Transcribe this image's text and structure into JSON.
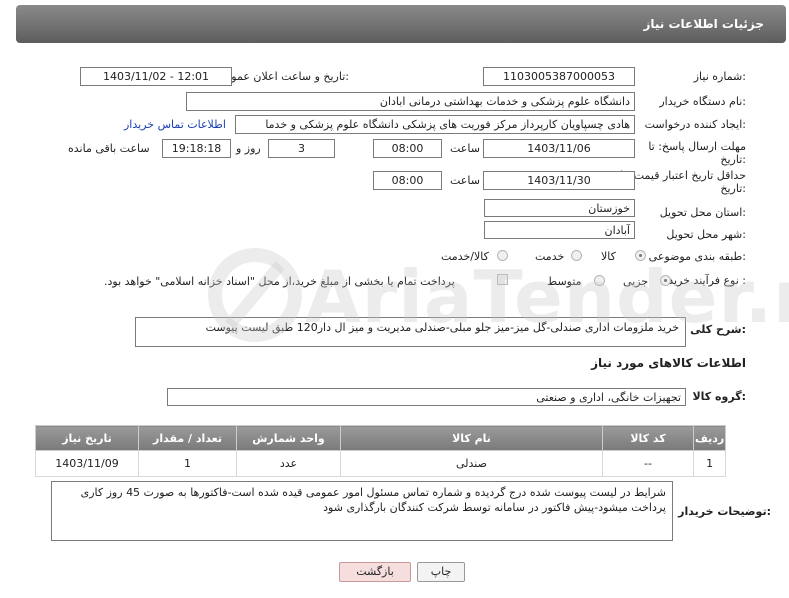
{
  "header": {
    "title": "جزئیات اطلاعات نیاز"
  },
  "form": {
    "need_number_label": "شماره نیاز:",
    "need_number": "1103005387000053",
    "announce_label": "تاریخ و ساعت اعلان عمومی:",
    "announce_value": "1403/11/02 - 12:01",
    "buyer_org_label": "نام دستگاه خریدار:",
    "buyer_org": "دانشگاه علوم پزشکی و خدمات بهداشتی  درمانی ابادان",
    "requester_label": "ایجاد کننده درخواست:",
    "requester": "هادی چسپاویان کارپرداز مرکز فوریت های پزشکی دانشگاه علوم پزشکی و خدما",
    "contact_link": "اطلاعات تماس خریدار",
    "deadline_label_1": "مهلت ارسال پاسخ: تا",
    "deadline_label_2": "تاریخ:",
    "deadline_date": "1403/11/06",
    "time_label": "ساعت",
    "deadline_time": "08:00",
    "days_value": "3",
    "days_label": "روز و",
    "remaining_time": "19:18:18",
    "remaining_label": "ساعت باقی مانده",
    "validity_label_1": "حداقل تاریخ اعتبار قیمت: تا",
    "validity_label_2": "تاریخ:",
    "validity_date": "1403/11/30",
    "validity_time": "08:00",
    "province_label": "استان محل تحویل:",
    "province": "خوزستان",
    "city_label": "شهر محل تحویل:",
    "city": "آبادان",
    "category_label": "طبقه بندی موضوعی:",
    "category_options": [
      "کالا",
      "خدمت",
      "کالا/خدمت"
    ],
    "process_label": "نوع فرآیند خرید :",
    "process_options": [
      "جزیی",
      "متوسط"
    ],
    "payment_text": "پرداخت تمام یا بخشی از مبلغ خرید،از محل \"اسناد خزانه اسلامی\" خواهد بود.",
    "summary_label": "شرح کلی نیاز:",
    "summary": "خرید ملزومات اداری صندلی-گل میز-میز جلو مبلی-صندلی مدیریت و میز ال دار120 طبق لیست پیوست",
    "goods_info_title": "اطلاعات کالاهای مورد نیاز",
    "goods_group_label": "گروه کالا:",
    "goods_group": "تجهیزات خانگی، اداری و صنعتی"
  },
  "table": {
    "headers": [
      "ردیف",
      "کد کالا",
      "نام کالا",
      "واحد شمارش",
      "تعداد / مقدار",
      "تاریخ نیاز"
    ],
    "rows": [
      [
        "1",
        "--",
        "صندلی",
        "عدد",
        "1",
        "1403/11/09"
      ]
    ]
  },
  "buyer_notes": {
    "label": "توضیحات خریدار:",
    "text": "شرایط در لیست پیوست شده درج گردیده و شماره تماس مسئول امور عمومی قیده شده است-فاکتورها به صورت 45 روز کاری پرداخت میشود-پیش فاکتور در سامانه توسط شرکت کنندگان بارگذاری شود"
  },
  "buttons": {
    "print": "چاپ",
    "back": "بازگشت"
  },
  "watermark": {
    "text": "AriaTender.neT"
  },
  "colors": {
    "link": "#1a3fb0",
    "header_bg": "#6b6b6b",
    "back_btn": "#f6dede"
  }
}
